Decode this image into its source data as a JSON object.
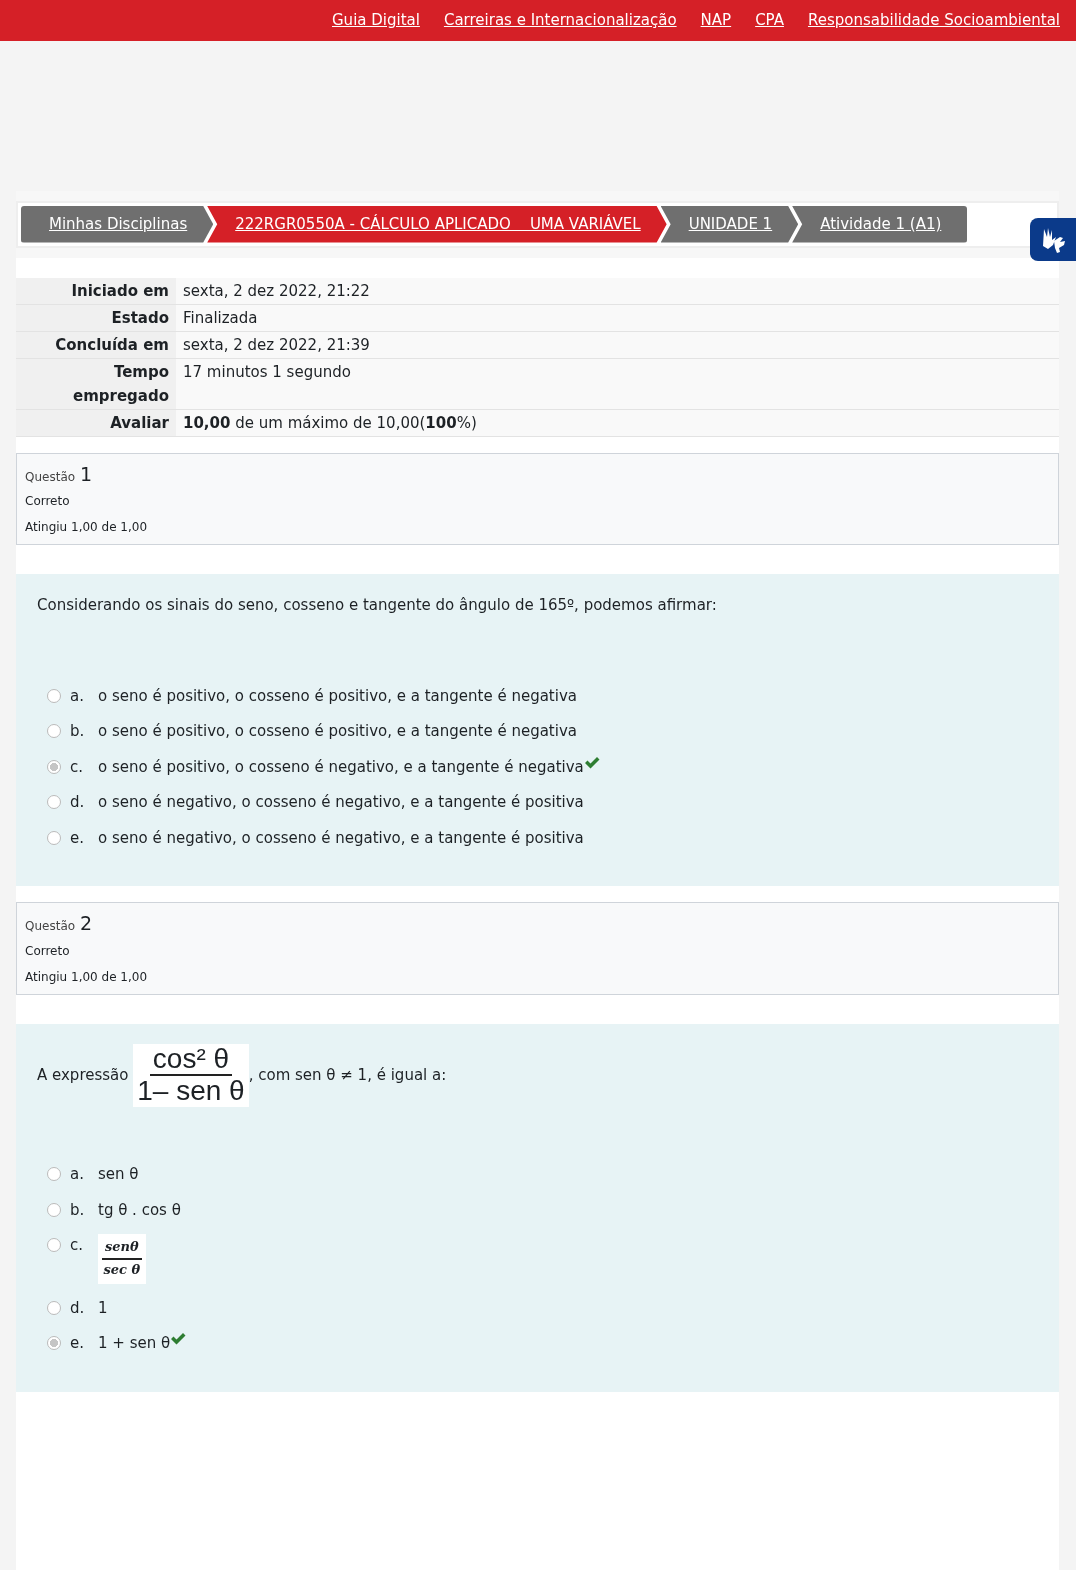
{
  "top_links": [
    "Guia Digital",
    "Carreiras e Internacionalização",
    "NAP",
    "CPA",
    "Responsabilidade Socioambiental"
  ],
  "breadcrumb": [
    {
      "label": "Minhas Disciplinas",
      "selected": false
    },
    {
      "label": "222RGR0550A - CÁLCULO APLICADO    UMA VARIÁVEL",
      "selected": true
    },
    {
      "label": "UNIDADE 1",
      "selected": false
    },
    {
      "label": "Atividade 1 (A1)",
      "selected": false
    }
  ],
  "summary": [
    {
      "label": "Iniciado em",
      "value": "sexta, 2 dez 2022, 21:22"
    },
    {
      "label": "Estado",
      "value": "Finalizada"
    },
    {
      "label": "Concluída em",
      "value": "sexta, 2 dez 2022, 21:39"
    },
    {
      "label": "Tempo empregado",
      "value": "17 minutos 1 segundo"
    },
    {
      "label": "Avaliar",
      "value": "**10,00** de um máximo de 10,00(**100**%)"
    }
  ],
  "questions": [
    {
      "label": "Questão",
      "number": "1",
      "state": "Correto",
      "grade": "Atingiu 1,00 de 1,00",
      "prompt": [
        {
          "kind": "text",
          "text": "Considerando os sinais do seno, cosseno e tangente do ângulo de 165º, podemos afirmar:"
        }
      ],
      "options": [
        {
          "letter": "a.",
          "kind": "text",
          "text": "o seno é positivo, o cosseno é positivo, e a tangente é negativa",
          "selected": false,
          "correct": false
        },
        {
          "letter": "b.",
          "kind": "text",
          "text": "o seno é positivo, o cosseno é positivo, e a tangente é negativa",
          "selected": false,
          "correct": false
        },
        {
          "letter": "c.",
          "kind": "text",
          "text": "o seno é positivo, o cosseno é negativo, e a tangente é negativa",
          "selected": true,
          "correct": true
        },
        {
          "letter": "d.",
          "kind": "text",
          "text": "o seno é negativo, o cosseno é negativo, e a tangente é positiva",
          "selected": false,
          "correct": false
        },
        {
          "letter": "e.",
          "kind": "text",
          "text": "o seno é negativo, o cosseno é negativo, e a tangente é positiva",
          "selected": false,
          "correct": false
        }
      ]
    },
    {
      "label": "Questão",
      "number": "2",
      "state": "Correto",
      "grade": "Atingiu 1,00 de 1,00",
      "prompt": [
        {
          "kind": "text",
          "text": "A expressão"
        },
        {
          "kind": "fraction",
          "numerator": "cos² θ",
          "denominator": "1– sen θ"
        },
        {
          "kind": "text",
          "text": ", com sen θ ≠ 1, é igual a:"
        }
      ],
      "options": [
        {
          "letter": "a.",
          "kind": "text",
          "text": "sen θ",
          "selected": false,
          "correct": false
        },
        {
          "letter": "b.",
          "kind": "text",
          "text": "tg θ . cos θ",
          "selected": false,
          "correct": false
        },
        {
          "letter": "c.",
          "kind": "fraction",
          "numerator": "senθ",
          "denominator": "sec θ",
          "selected": false,
          "correct": false
        },
        {
          "letter": "d.",
          "kind": "text",
          "text": "1",
          "selected": false,
          "correct": false
        },
        {
          "letter": "e.",
          "kind": "text",
          "text": "1 + sen θ",
          "selected": true,
          "correct": true
        }
      ]
    }
  ]
}
